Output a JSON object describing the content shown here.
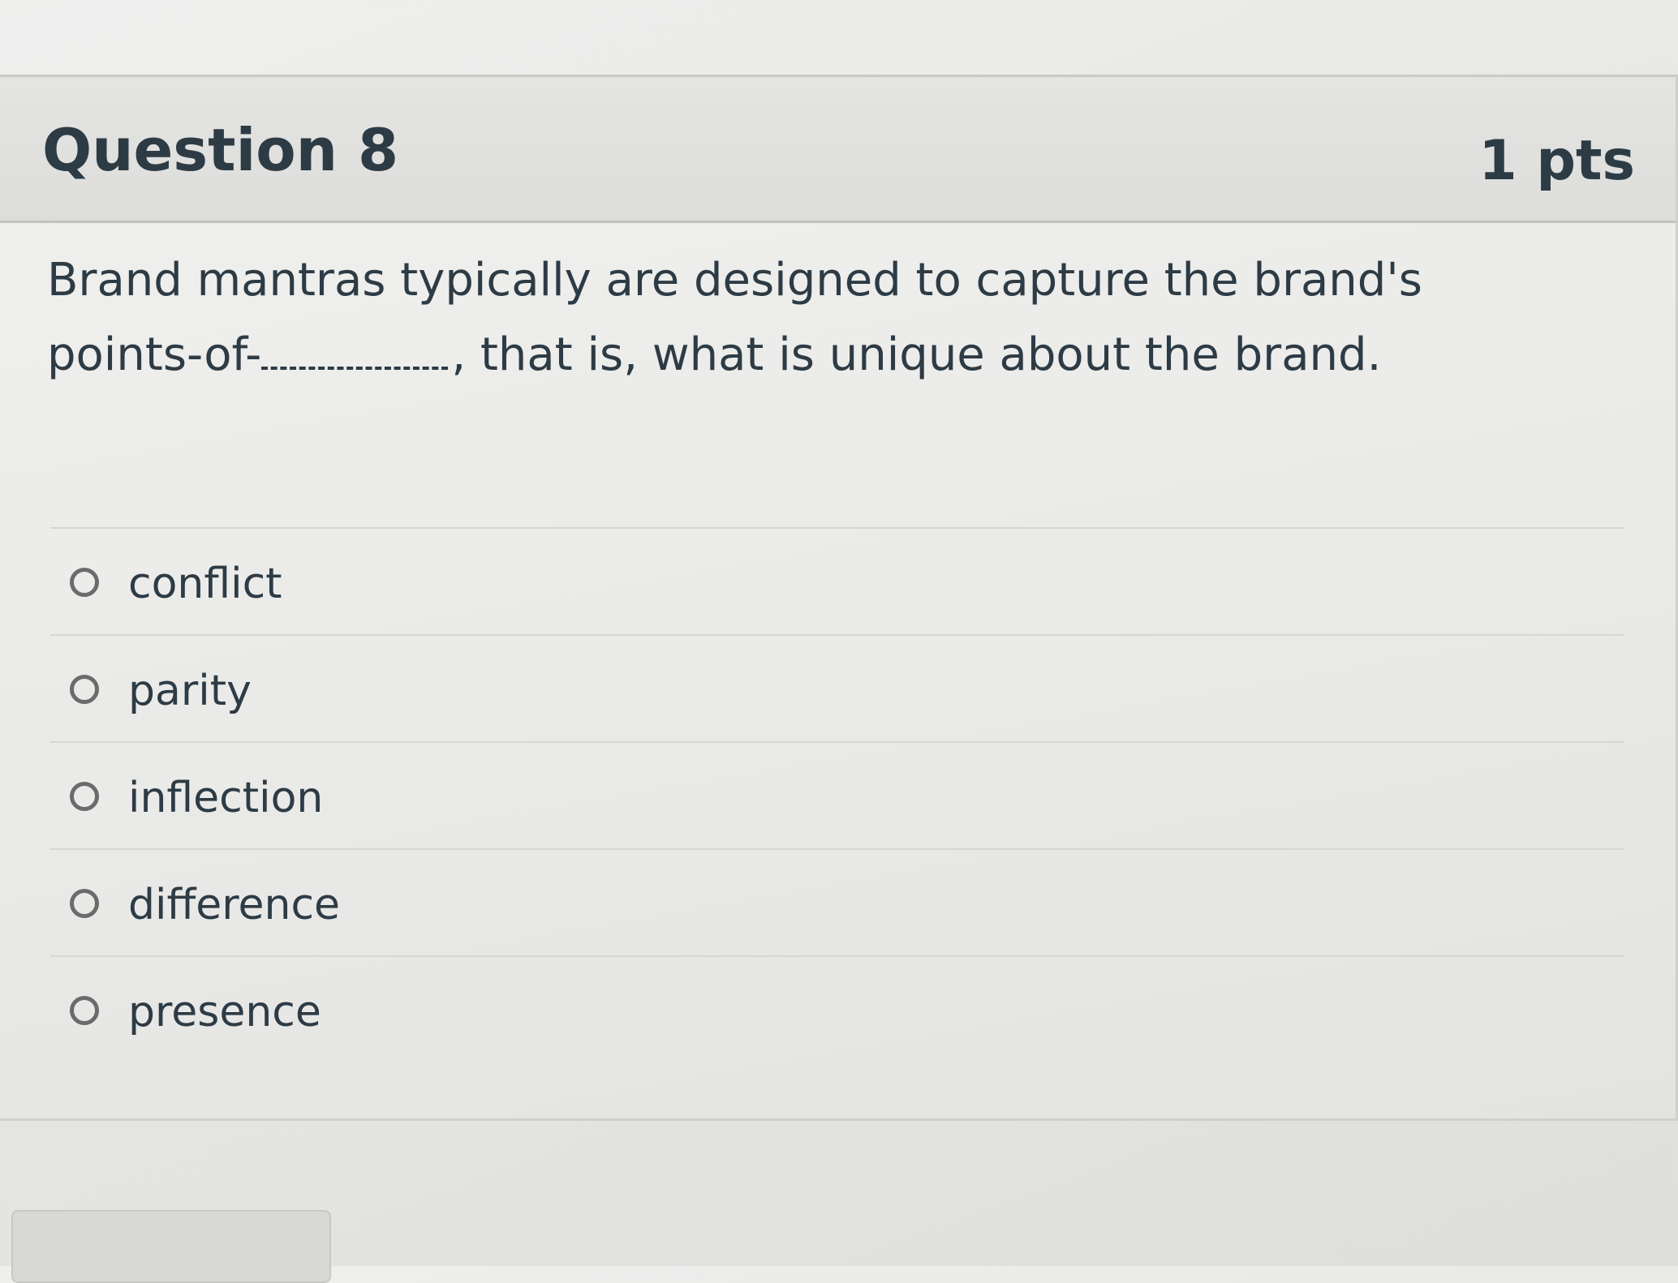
{
  "question": {
    "title": "Question 8",
    "points": "1 pts",
    "text_before": "Brand mantras typically are designed to capture the brand's points-of-",
    "text_after": ", that is, what is unique about the brand."
  },
  "answers": [
    {
      "label": "conflict",
      "selected": false
    },
    {
      "label": "parity",
      "selected": false
    },
    {
      "label": "inflection",
      "selected": false
    },
    {
      "label": "difference",
      "selected": false
    },
    {
      "label": "presence",
      "selected": false
    }
  ]
}
